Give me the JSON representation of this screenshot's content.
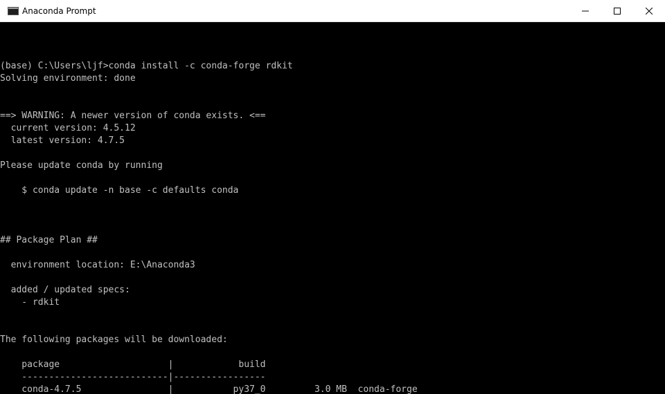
{
  "window": {
    "title": "Anaconda Prompt",
    "icon": "console-icon",
    "controls": {
      "minimize_icon": "minimize-icon",
      "maximize_icon": "maximize-icon",
      "close_icon": "close-icon"
    }
  },
  "colors": {
    "console_background": "#000000",
    "console_text": "#c0c0c0",
    "titlebar_background": "#ffffff"
  },
  "console": {
    "lines": [
      "(base) C:\\Users\\ljf>conda install -c conda-forge rdkit",
      "Solving environment: done",
      "",
      "",
      "==> WARNING: A newer version of conda exists. <==",
      "  current version: 4.5.12",
      "  latest version: 4.7.5",
      "",
      "Please update conda by running",
      "",
      "    $ conda update -n base -c defaults conda",
      "",
      "",
      "",
      "## Package Plan ##",
      "",
      "  environment location: E:\\Anaconda3",
      "",
      "  added / updated specs:",
      "    - rdkit",
      "",
      "",
      "The following packages will be downloaded:",
      "",
      "    package                    |            build",
      "    ---------------------------|-----------------",
      "    conda-4.7.5                |           py37_0         3.0 MB  conda-forge"
    ]
  }
}
